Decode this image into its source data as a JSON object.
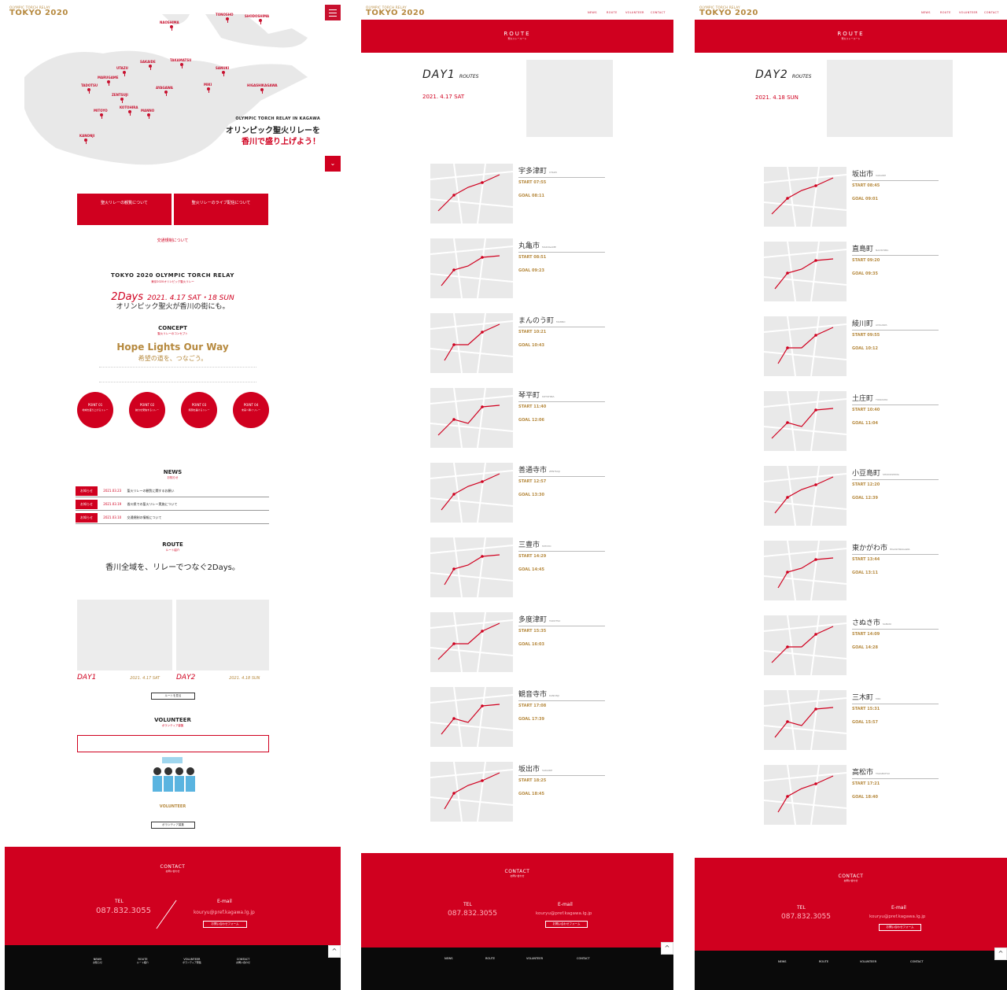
{
  "brand": {
    "line1": "OLYMPIC TORCH RELAY",
    "line2": "TOKYO 2020"
  },
  "colors": {
    "red": "#d0001f",
    "gold": "#b6893e",
    "black": "#0a0a0a"
  },
  "nav": {
    "news": "NEWS",
    "route": "ROUTE",
    "volunteer": "VOLUNTEER",
    "contact": "CONTACT"
  },
  "hero": {
    "tagline": "OLYMPIC TORCH RELAY IN KAGAWA",
    "head1": "オリンピック聖火リレーを",
    "head2": "香川で盛り上げよう！",
    "towns": [
      "TONOSHO",
      "SHODOSHIMA",
      "NAOSHIMA",
      "SAKAIDE",
      "TAKAMATSU",
      "UTAZU",
      "SANUKI",
      "MARUGAME",
      "TADOTSU",
      "AYAGAWA",
      "MIKI",
      "HIGASHIKAGAWA",
      "ZENTSUJI",
      "KOTOHIRA",
      "MANNO",
      "MITOYO",
      "KANONJI"
    ]
  },
  "notices": {
    "a": "聖火リレーの観覧について",
    "b": "聖火リレーのライブ配信について",
    "c": "交通規制について"
  },
  "intro": {
    "title": "TOKYO 2020 OLYMPIC TORCH RELAY",
    "sub": "東京2020オリンピック聖火リレー",
    "days": "2Days",
    "dates": "2021. 4.17 SAT・18 SUN",
    "line": "オリンピック聖火が香川の街にも。"
  },
  "concept": {
    "label": "CONCEPT",
    "sub": "聖火リレーのコンセプト",
    "title": "Hope Lights Our Way",
    "jp": "希望の道を、つなごう。",
    "points": [
      {
        "n": "POINT 01",
        "t": "地域を盛り上げるリレー"
      },
      {
        "n": "POINT 02",
        "t": "魅力を発信するリレー"
      },
      {
        "n": "POINT 03",
        "t": "笑顔を届けるリレー"
      },
      {
        "n": "POINT 04",
        "t": "未来へ繋ぐリレー"
      }
    ]
  },
  "news": {
    "label": "NEWS",
    "sub": "お知らせ",
    "items": [
      {
        "tag": "お知らせ",
        "date": "2021.03.23",
        "text": "聖火リレーの観覧に関するお願い"
      },
      {
        "tag": "お知らせ",
        "date": "2021.03.19",
        "text": "香川県での聖火リレー実施について"
      },
      {
        "tag": "お知らせ",
        "date": "2021.03.10",
        "text": "交通規制の情報について"
      }
    ]
  },
  "route_section": {
    "label": "ROUTE",
    "sub": "ルート紹介",
    "lead": "香川全域を、リレーでつなぐ2Days。",
    "day1": "DAY1",
    "day1_date": "2021. 4.17 SAT",
    "day2": "DAY2",
    "day2_date": "2021. 4.18 SUN",
    "btn": "ルートを見る"
  },
  "volunteer": {
    "label": "VOLUNTEER",
    "sub": "ボランティア募集",
    "caption": "VOLUNTEER",
    "btn": "ボランティア募集"
  },
  "contact": {
    "label": "CONTACT",
    "sub": "お問い合わせ",
    "tel_label": "TEL",
    "tel": "087.832.3055",
    "mail_label": "E-mail",
    "mail": "kouryu@pref.kagawa.lg.jp",
    "form_btn": "お問い合わせフォーム"
  },
  "footer_nav": [
    {
      "en": "NEWS",
      "jp": "お知らせ"
    },
    {
      "en": "ROUTE",
      "jp": "ルート紹介"
    },
    {
      "en": "VOLUNTEER",
      "jp": "ボランティア募集"
    },
    {
      "en": "CONTACT",
      "jp": "お問い合わせ"
    }
  ],
  "route_page": {
    "title": "ROUTE",
    "sub": "聖火リレールート",
    "day1": {
      "label": "DAY1",
      "routes": "ROUTES",
      "date": "2021. 4.17 SAT"
    },
    "day2": {
      "label": "DAY2",
      "routes": "ROUTES",
      "date": "2021. 4.18 SUN"
    },
    "day1_list": [
      {
        "jp": "宇多津町",
        "en": "UTAZU",
        "start": "START 07:55",
        "goal": "GOAL 08:11"
      },
      {
        "jp": "丸亀市",
        "en": "MARUGAME",
        "start": "START 08:51",
        "goal": "GOAL 09:23"
      },
      {
        "jp": "まんのう町",
        "en": "MANNO",
        "start": "START 10:21",
        "goal": "GOAL 10:43"
      },
      {
        "jp": "琴平町",
        "en": "KOTOHIRA",
        "start": "START 11:40",
        "goal": "GOAL 12:06"
      },
      {
        "jp": "善通寺市",
        "en": "ZENTSUJI",
        "start": "START 12:57",
        "goal": "GOAL 13:30"
      },
      {
        "jp": "三豊市",
        "en": "MITOYO",
        "start": "START 14:29",
        "goal": "GOAL 14:45"
      },
      {
        "jp": "多度津町",
        "en": "TADOTSU",
        "start": "START 15:35",
        "goal": "GOAL 16:03"
      },
      {
        "jp": "観音寺市",
        "en": "KANONJI",
        "start": "START 17:08",
        "goal": "GOAL 17:39"
      },
      {
        "jp": "坂出市",
        "en": "SAKAIDE",
        "start": "START 18:25",
        "goal": "GOAL 18:45"
      }
    ],
    "day2_list": [
      {
        "jp": "坂出市",
        "en": "SAKAIDE",
        "start": "START 08:45",
        "goal": "GOAL 09:01"
      },
      {
        "jp": "直島町",
        "en": "NAOSHIMA",
        "start": "START 09:20",
        "goal": "GOAL 09:35"
      },
      {
        "jp": "綾川町",
        "en": "AYAGAWA",
        "start": "START 09:55",
        "goal": "GOAL 10:12"
      },
      {
        "jp": "土庄町",
        "en": "TONOSHO",
        "start": "START 10:40",
        "goal": "GOAL 11:04"
      },
      {
        "jp": "小豆島町",
        "en": "SHODOSHIMA",
        "start": "START 12:20",
        "goal": "GOAL 12:39"
      },
      {
        "jp": "東かがわ市",
        "en": "HIGASHIKAGAWA",
        "start": "START 13:44",
        "goal": "GOAL 13:11"
      },
      {
        "jp": "さぬき市",
        "en": "SANUKI",
        "start": "START 14:09",
        "goal": "GOAL 14:28"
      },
      {
        "jp": "三木町",
        "en": "MIKI",
        "start": "START 15:31",
        "goal": "GOAL 15:57"
      },
      {
        "jp": "高松市",
        "en": "TAKAMATSU",
        "start": "START 17:21",
        "goal": "GOAL 18:40"
      }
    ]
  }
}
